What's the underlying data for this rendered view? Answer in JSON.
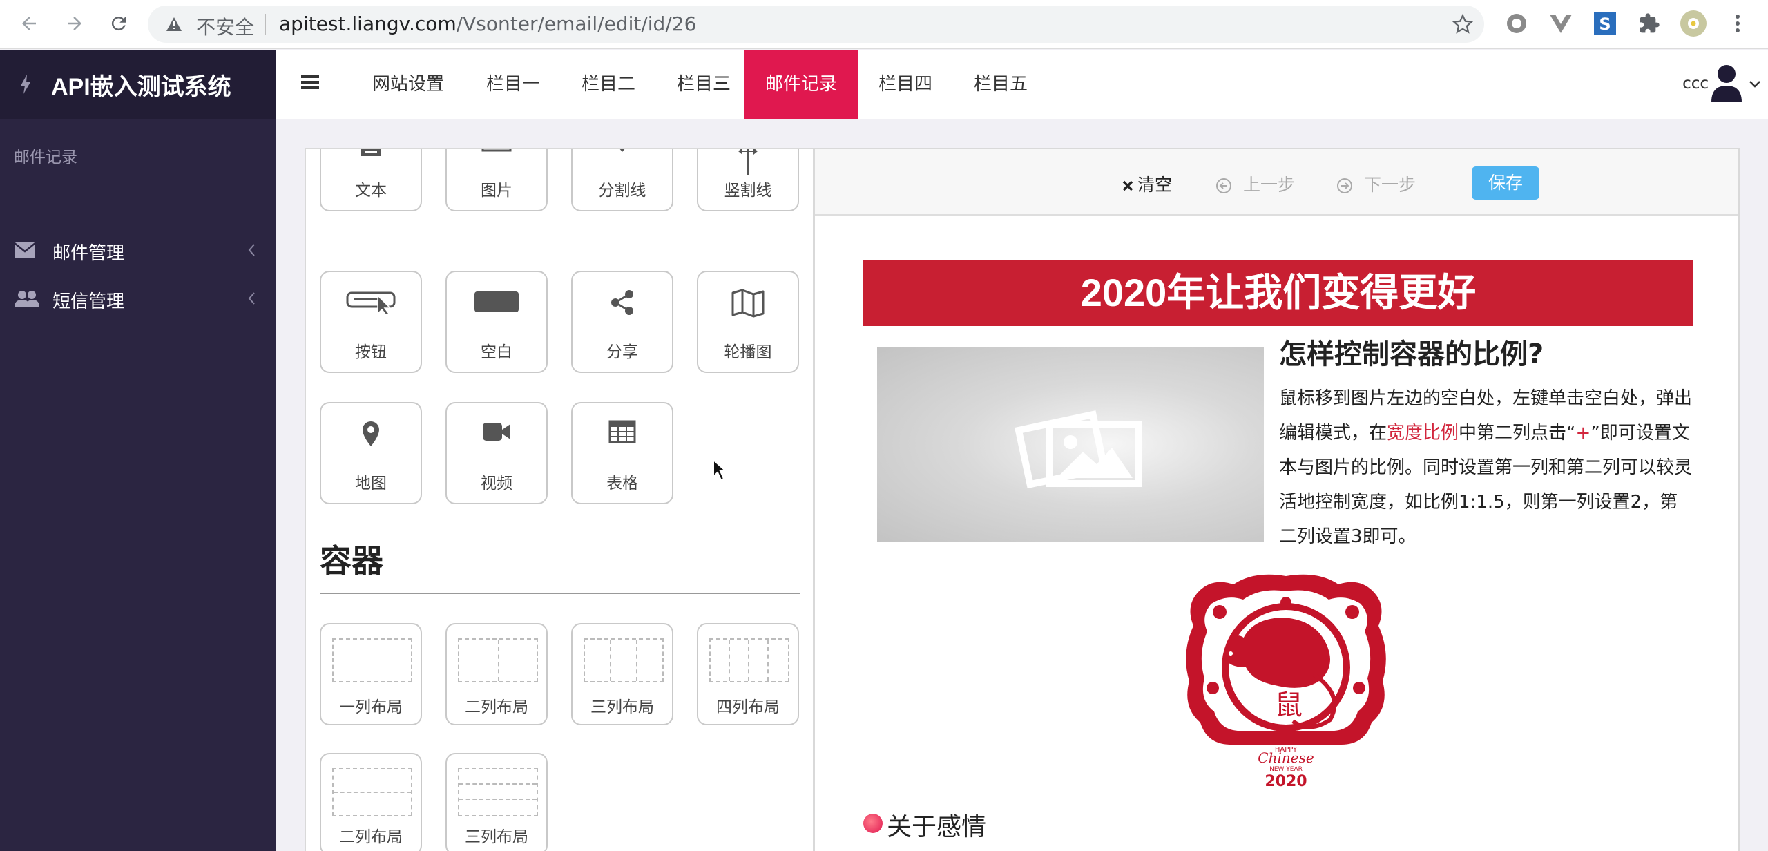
{
  "browser": {
    "insecure_label": "不安全",
    "url_host": "apitest.liangv.com",
    "url_path": "/Vsonter/email/edit/id/26"
  },
  "sidebar": {
    "title": "API嵌入测试系统",
    "section": "邮件记录",
    "items": [
      {
        "label": "邮件管理",
        "icon": "envelope-icon"
      },
      {
        "label": "短信管理",
        "icon": "users-icon"
      }
    ]
  },
  "topnav": {
    "items": [
      {
        "label": "网站设置",
        "active": false
      },
      {
        "label": "栏目一",
        "active": false
      },
      {
        "label": "栏目二",
        "active": false
      },
      {
        "label": "栏目三",
        "active": false
      },
      {
        "label": "邮件记录",
        "active": true
      },
      {
        "label": "栏目四",
        "active": false
      },
      {
        "label": "栏目五",
        "active": false
      }
    ],
    "user": "ccc",
    "active_color": "#e0184f"
  },
  "palette": {
    "tools": [
      {
        "label": "文本",
        "icon": "file-icon"
      },
      {
        "label": "图片",
        "icon": "image-icon"
      },
      {
        "label": "分割线",
        "icon": "divider-icon"
      },
      {
        "label": "竖割线",
        "icon": "vertical-divider-icon"
      },
      {
        "label": "按钮",
        "icon": "button-icon"
      },
      {
        "label": "空白",
        "icon": "blank-icon"
      },
      {
        "label": "分享",
        "icon": "share-icon"
      },
      {
        "label": "轮播图",
        "icon": "map-fold-icon"
      },
      {
        "label": "地图",
        "icon": "map-pin-icon"
      },
      {
        "label": "视频",
        "icon": "video-icon"
      },
      {
        "label": "表格",
        "icon": "table-icon"
      }
    ],
    "container_heading": "容器",
    "layouts": [
      {
        "label": "一列布局"
      },
      {
        "label": "二列布局"
      },
      {
        "label": "三列布局"
      },
      {
        "label": "四列布局"
      },
      {
        "label": "二列布局"
      },
      {
        "label": "三列布局"
      }
    ]
  },
  "editor": {
    "toolbar": {
      "clear": "清空",
      "undo": "上一步",
      "redo": "下一步",
      "save": "保存"
    },
    "banner": "2020年让我们变得更好",
    "article_title": "怎样控制容器的比例?",
    "body_part1": "鼠标移到图片左边的空白处，左键单击空白处，弹出编辑模式，在",
    "body_highlight": "宽度比例",
    "body_part2": "中第二列点击“",
    "body_plus": "+",
    "body_part3": "”即可设置文本与图片的比例。同时设置第一列和第二列可以较灵活地控制宽度，如比例1:1.5，则第一列设置2，第二列设置3即可。",
    "zodiac_char": "鼠",
    "zodiac_caption_1": "HAPPY",
    "zodiac_caption_2": "Chinese",
    "zodiac_caption_3": "NEW YEAR",
    "zodiac_year": "2020",
    "section_title": "关于感情",
    "banner_color": "#c81f32",
    "save_color": "#4fb4f0"
  }
}
